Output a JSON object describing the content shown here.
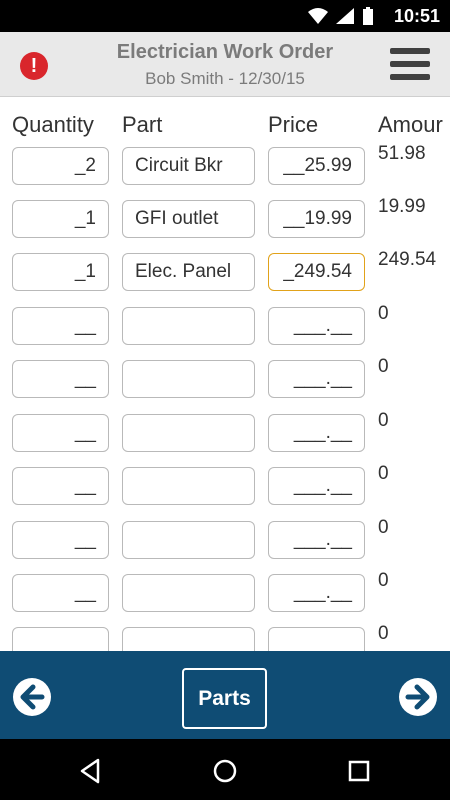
{
  "status": {
    "time": "10:51"
  },
  "header": {
    "title": "Electrician Work Order",
    "subtitle": "Bob Smith - 12/30/15"
  },
  "columns": {
    "quantity": "Quantity",
    "part": "Part",
    "price": "Price",
    "amount": "Amour"
  },
  "rows": [
    {
      "quantity": "_2",
      "part": "Circuit Bkr",
      "price": "__25.99",
      "amount": "51.98"
    },
    {
      "quantity": "_1",
      "part": "GFI outlet",
      "price": "__19.99",
      "amount": "19.99"
    },
    {
      "quantity": "_1",
      "part": "Elec. Panel",
      "price": "_249.54",
      "amount": "249.54"
    },
    {
      "quantity": "__",
      "part": "",
      "price": "___.__",
      "amount": "0"
    },
    {
      "quantity": "__",
      "part": "",
      "price": "___.__",
      "amount": "0"
    },
    {
      "quantity": "__",
      "part": "",
      "price": "___.__",
      "amount": "0"
    },
    {
      "quantity": "__",
      "part": "",
      "price": "___.__",
      "amount": "0"
    },
    {
      "quantity": "__",
      "part": "",
      "price": "___.__",
      "amount": "0"
    },
    {
      "quantity": "__",
      "part": "",
      "price": "___.__",
      "amount": "0"
    },
    {
      "quantity": "",
      "part": "",
      "price": "",
      "amount": "0"
    }
  ],
  "bottom": {
    "parts_label": "Parts"
  },
  "icons": {
    "alert": "alert-icon",
    "menu": "hamburger-menu-icon",
    "back": "arrow-left-icon",
    "next": "arrow-right-icon",
    "nav_back": "nav-back-icon",
    "nav_home": "nav-home-icon",
    "nav_recent": "nav-recent-icon"
  },
  "colors": {
    "bottom_bar": "#0f4c74",
    "alert": "#d9262c",
    "focus_border": "#e1a21a"
  }
}
